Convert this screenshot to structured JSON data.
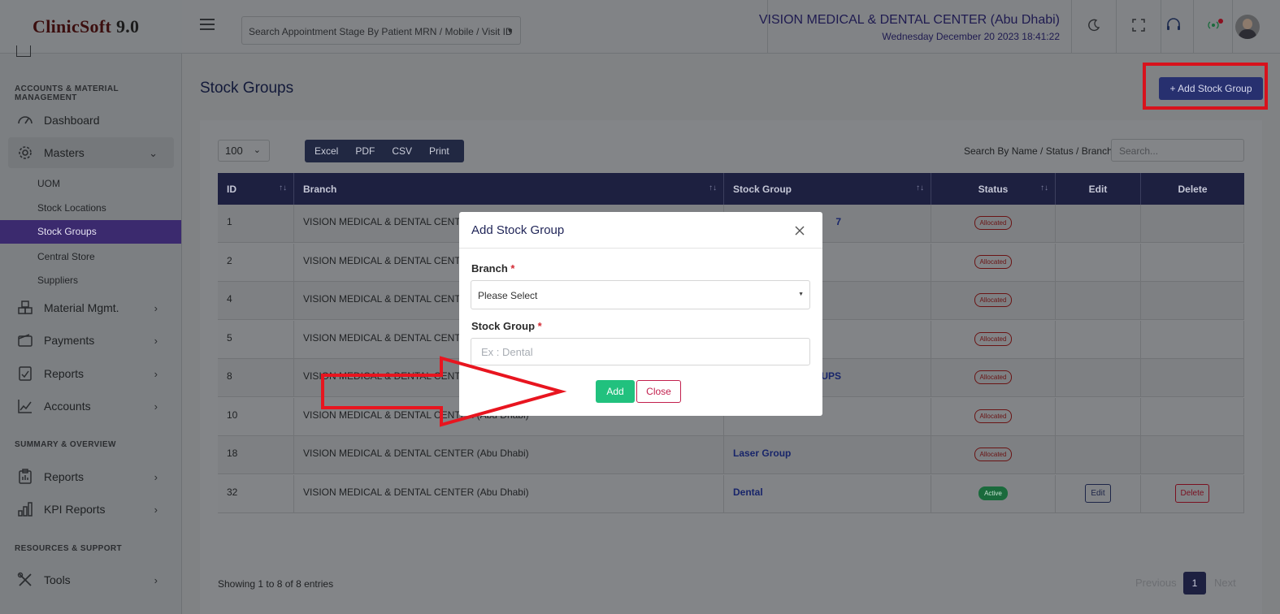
{
  "app": {
    "brand": "ClinicSoft",
    "version": "9.0"
  },
  "sidebar": {
    "section_accounts": "ACCOUNTS & MATERIAL MANAGEMENT",
    "section_summary": "SUMMARY & OVERVIEW",
    "section_resources": "RESOURCES & SUPPORT",
    "items": {
      "dashboard": "Dashboard",
      "masters": "Masters",
      "material": "Material Mgmt.",
      "payments": "Payments",
      "reports": "Reports",
      "accounts": "Accounts",
      "reports2": "Reports",
      "kpi": "KPI Reports",
      "tools": "Tools"
    },
    "masters_sub": {
      "uom": "UOM",
      "stock_locations": "Stock Locations",
      "stock_groups": "Stock Groups",
      "central_store": "Central Store",
      "suppliers": "Suppliers"
    }
  },
  "header": {
    "search_placeholder": "Search Appointment Stage By Patient MRN / Mobile / Visit ID",
    "clinic_name": "VISION MEDICAL & DENTAL CENTER (Abu Dhabi)",
    "datetime": "Wednesday December 20 2023 18:41:22"
  },
  "page": {
    "title": "Stock Groups",
    "add_button": "+ Add Stock Group",
    "page_length": "100",
    "export": [
      "Excel",
      "PDF",
      "CSV",
      "Print"
    ],
    "search_label": "Search By Name / Status / Branch",
    "search_placeholder": "Search..."
  },
  "table": {
    "headers": [
      "ID",
      "Branch",
      "Stock Group",
      "Status",
      "Edit",
      "Delete"
    ],
    "rows": [
      {
        "id": "1",
        "branch": "VISION MEDICAL & DENTAL CENTER (Abu Dhabi)",
        "group": "7",
        "status": "Allocated"
      },
      {
        "id": "2",
        "branch": "VISION MEDICAL & DENTAL CENTER (Abu Dhabi)",
        "group": "",
        "status": "Allocated"
      },
      {
        "id": "4",
        "branch": "VISION MEDICAL & DENTAL CENTER (Abu Dhabi)",
        "group": "",
        "status": "Allocated"
      },
      {
        "id": "5",
        "branch": "VISION MEDICAL & DENTAL CENTER (Abu Dhabi)",
        "group": "",
        "status": "Allocated"
      },
      {
        "id": "8",
        "branch": "VISION MEDICAL & DENTAL CENTER (Abu Dhabi)",
        "group": "UPS",
        "status": "Allocated"
      },
      {
        "id": "10",
        "branch": "VISION MEDICAL & DENTAL CENTER (Abu Dhabi)",
        "group": "",
        "status": "Allocated"
      },
      {
        "id": "18",
        "branch": "VISION MEDICAL & DENTAL CENTER (Abu Dhabi)",
        "group": "Laser Group",
        "status": "Allocated"
      },
      {
        "id": "32",
        "branch": "VISION MEDICAL & DENTAL CENTER (Abu Dhabi)",
        "group": "Dental",
        "status": "Active",
        "edit": "Edit",
        "delete": "Delete"
      }
    ]
  },
  "footer": {
    "showing": "Showing 1 to 8 of 8 entries",
    "prev": "Previous",
    "page": "1",
    "next": "Next"
  },
  "modal": {
    "title": "Add Stock Group",
    "branch_label": "Branch",
    "branch_value": "Please Select",
    "group_label": "Stock Group",
    "group_placeholder": "Ex : Dental",
    "required_mark": "*",
    "add": "Add",
    "close": "Close"
  },
  "colors": {
    "accent": "#3c4bbd",
    "annotation": "#e8151f",
    "add_green": "#21c17e",
    "close_red": "#c21f4d"
  }
}
